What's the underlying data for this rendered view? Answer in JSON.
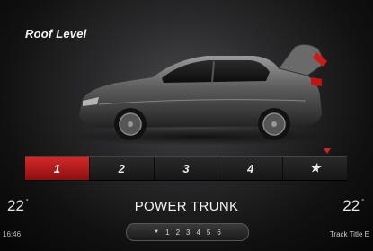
{
  "screen_title": "Roof Level",
  "levels": [
    "1",
    "2",
    "3",
    "4",
    "★"
  ],
  "active_level": "1",
  "function_title": "POWER TRUNK",
  "temp_left": "22",
  "temp_right": "22",
  "degree_symbol": "°",
  "clock": "16:46",
  "preset_arrow": "▼",
  "presets": [
    "1",
    "2",
    "3",
    "4",
    "5",
    "6"
  ],
  "track_label": "Track Title",
  "track_trailing": "E",
  "colors": {
    "accent": "#d42a2a",
    "marker": "#d92020"
  }
}
